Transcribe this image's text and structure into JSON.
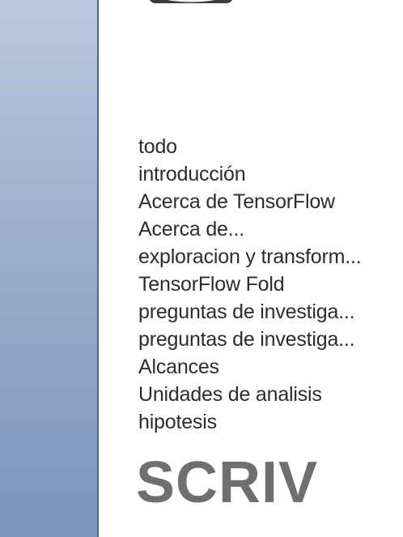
{
  "sidebar": {
    "color": "#8fa6c8"
  },
  "app_icon": {
    "icon": "app-icon"
  },
  "documents": [
    "todo",
    "introducción",
    "Acerca de TensorFlow",
    "Acerca de...",
    "exploracion y transform...",
    "TensorFlow Fold",
    "preguntas de investiga...",
    "preguntas de investiga...",
    "Alcances",
    "Unidades de analisis",
    "hipotesis"
  ],
  "watermark": {
    "text": "SCRIV"
  }
}
